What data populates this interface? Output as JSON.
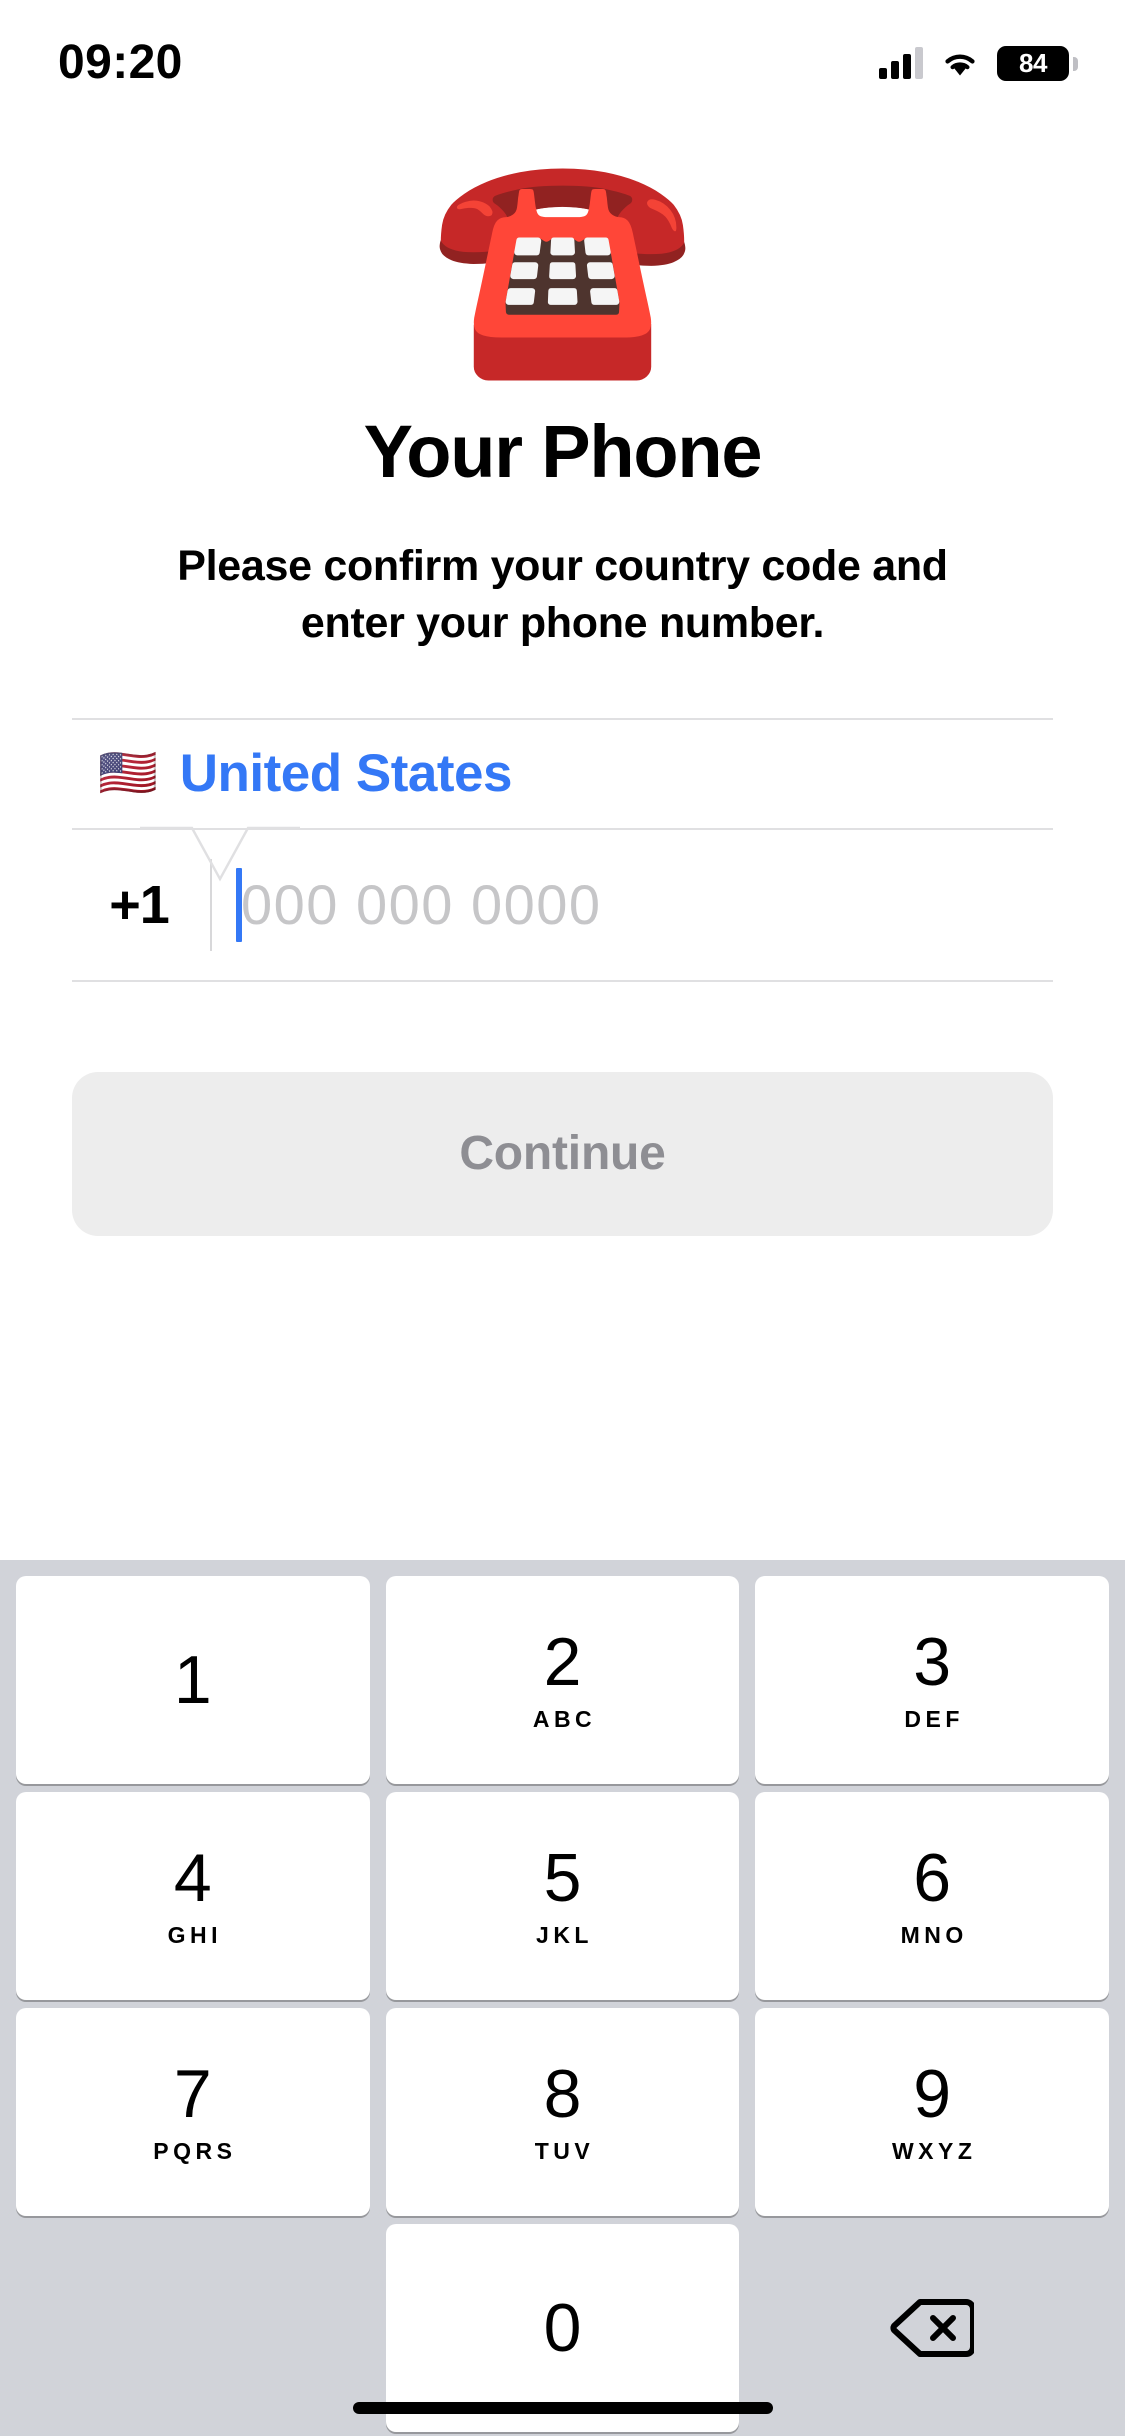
{
  "status_bar": {
    "time": "09:20",
    "battery_level": "84",
    "cellular_icon": "signal-bars-icon",
    "wifi_icon": "wifi-icon",
    "battery_icon": "battery-icon"
  },
  "hero": {
    "emoji": "☎️",
    "emoji_name": "telephone-emoji",
    "title": "Your Phone",
    "subtitle": "Please confirm your country code and enter your phone number."
  },
  "form": {
    "country": {
      "flag": "🇺🇸",
      "name": "United States",
      "accent_color": "#3478F6"
    },
    "phone": {
      "country_code": "+1",
      "value": "",
      "placeholder": "000 000 0000",
      "caret_color": "#3478F6",
      "placeholder_color": "#C6C6C8"
    },
    "continue_button": {
      "label": "Continue",
      "enabled": false,
      "background": "#EDEDED",
      "text_color": "#8E8E93"
    }
  },
  "keypad": {
    "background": "#D1D3D9",
    "key_background": "#FFFFFF",
    "rows": [
      [
        {
          "digit": "1",
          "letters": ""
        },
        {
          "digit": "2",
          "letters": "ABC"
        },
        {
          "digit": "3",
          "letters": "DEF"
        }
      ],
      [
        {
          "digit": "4",
          "letters": "GHI"
        },
        {
          "digit": "5",
          "letters": "JKL"
        },
        {
          "digit": "6",
          "letters": "MNO"
        }
      ],
      [
        {
          "digit": "7",
          "letters": "PQRS"
        },
        {
          "digit": "8",
          "letters": "TUV"
        },
        {
          "digit": "9",
          "letters": "WXYZ"
        }
      ],
      [
        {
          "digit": "",
          "letters": "",
          "type": "blank"
        },
        {
          "digit": "0",
          "letters": ""
        },
        {
          "digit": "",
          "letters": "",
          "type": "delete",
          "icon": "backspace-icon"
        }
      ]
    ]
  }
}
